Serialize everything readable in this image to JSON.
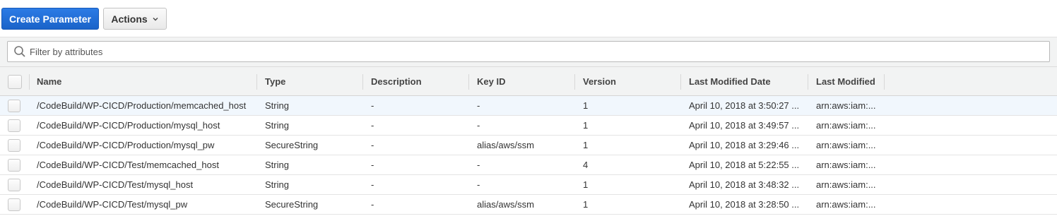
{
  "toolbar": {
    "create_label": "Create Parameter",
    "actions_label": "Actions"
  },
  "filter": {
    "placeholder": "Filter by attributes"
  },
  "table": {
    "columns": [
      "Name",
      "Type",
      "Description",
      "Key ID",
      "Version",
      "Last Modified Date",
      "Last Modified"
    ],
    "rows": [
      {
        "name": "/CodeBuild/WP-CICD/Production/memcached_host",
        "type": "String",
        "description": "-",
        "key_id": "-",
        "version": "1",
        "date": "April 10, 2018 at 3:50:27 ...",
        "user": "arn:aws:iam:..."
      },
      {
        "name": "/CodeBuild/WP-CICD/Production/mysql_host",
        "type": "String",
        "description": "-",
        "key_id": "-",
        "version": "1",
        "date": "April 10, 2018 at 3:49:57 ...",
        "user": "arn:aws:iam:..."
      },
      {
        "name": "/CodeBuild/WP-CICD/Production/mysql_pw",
        "type": "SecureString",
        "description": "-",
        "key_id": "alias/aws/ssm",
        "version": "1",
        "date": "April 10, 2018 at 3:29:46 ...",
        "user": "arn:aws:iam:..."
      },
      {
        "name": "/CodeBuild/WP-CICD/Test/memcached_host",
        "type": "String",
        "description": "-",
        "key_id": "-",
        "version": "4",
        "date": "April 10, 2018 at 5:22:55 ...",
        "user": "arn:aws:iam:..."
      },
      {
        "name": "/CodeBuild/WP-CICD/Test/mysql_host",
        "type": "String",
        "description": "-",
        "key_id": "-",
        "version": "1",
        "date": "April 10, 2018 at 3:48:32 ...",
        "user": "arn:aws:iam:..."
      },
      {
        "name": "/CodeBuild/WP-CICD/Test/mysql_pw",
        "type": "SecureString",
        "description": "-",
        "key_id": "alias/aws/ssm",
        "version": "1",
        "date": "April 10, 2018 at 3:28:50 ...",
        "user": "arn:aws:iam:..."
      }
    ]
  },
  "colors": {
    "primary": "#1a63c9",
    "row_highlight": "#f1f7fd",
    "header_bg": "#f2f3f3"
  }
}
